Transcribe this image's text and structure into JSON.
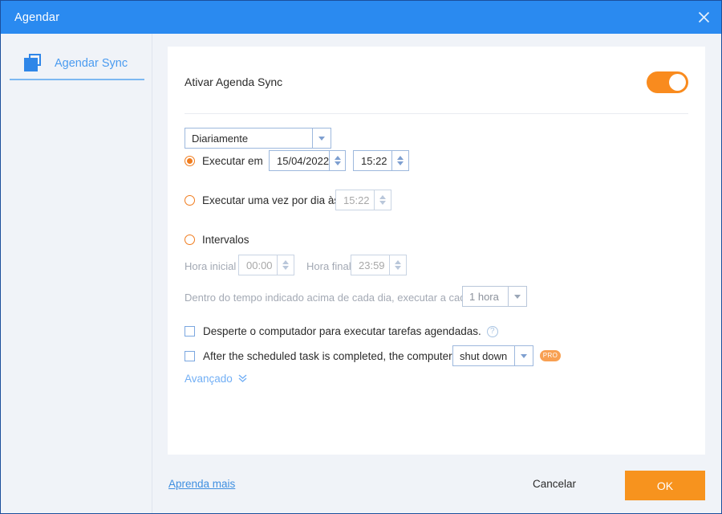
{
  "window": {
    "title": "Agendar",
    "close_icon": "close-icon"
  },
  "sidebar": {
    "items": [
      {
        "label": "Agendar Sync",
        "icon": "copy-squares-icon",
        "active": true
      }
    ]
  },
  "main": {
    "activate": {
      "label": "Ativar Agenda Sync",
      "toggle_on": true,
      "toggle_color": "#f98b1e"
    },
    "frequency": {
      "selected": "Diariamente"
    },
    "run_at": {
      "radio_label": "Executar em",
      "selected": true,
      "date_value": "15/04/2022",
      "time_value": "15:22"
    },
    "once_per_day": {
      "radio_label": "Executar uma vez por dia às",
      "selected": false,
      "time_value": "15:22"
    },
    "intervals": {
      "radio_label": "Intervalos",
      "selected": false,
      "start_label": "Hora inicial",
      "start_value": "00:00",
      "end_label": "Hora final",
      "end_value": "23:59",
      "every_label": "Dentro do tempo indicado acima de cada dia, executar a cada",
      "every_value": "1 hora"
    },
    "wake_computer": {
      "label": "Desperte o computador para executar tarefas agendadas.",
      "checked": false,
      "help_icon": "question-mark-icon",
      "help_glyph": "?"
    },
    "after_task": {
      "label": "After the scheduled task is completed, the computer will",
      "checked": false,
      "action_value": "shut down",
      "badge": "PRO"
    },
    "advanced": {
      "label": "Avançado",
      "chevron": "»"
    }
  },
  "footer": {
    "learn_more": "Aprenda mais",
    "cancel": "Cancelar",
    "ok": "OK",
    "ok_color": "#f7931e"
  }
}
